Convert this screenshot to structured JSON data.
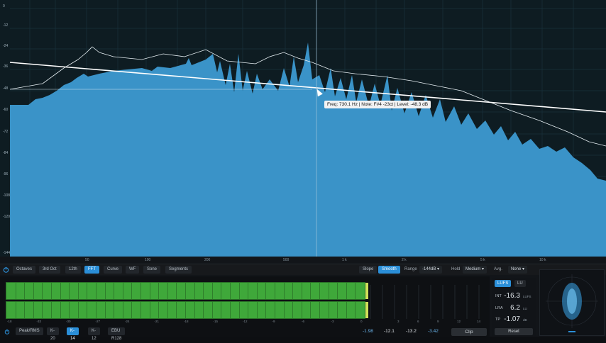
{
  "spectrum": {
    "y_labels": [
      "0",
      "-12",
      "-24",
      "-36",
      "-48",
      "-60",
      "-72",
      "-84",
      "-96",
      "-108",
      "-120",
      "-144"
    ],
    "x_labels": [
      "50",
      "100",
      "200",
      "500",
      "1 k",
      "2 k",
      "5 k",
      "10 k"
    ],
    "tooltip": "Freq: 730.1 Hz | Note: F#4 -23ct | Level: -48.3 dB",
    "fill_color": "#3a93c8"
  },
  "toolbar": {
    "view_modes": [
      "Octaves",
      "3rd Oct",
      "12th",
      "FFT",
      "Curve",
      "WF",
      "Sone",
      "Segments"
    ],
    "active_view": "FFT",
    "slope_label": "Slope",
    "smooth_label": "Smooth",
    "range_label": "Range",
    "range_value": "-144dB",
    "hold_label": "Hold",
    "hold_value": "Medium",
    "avg_label": "Avg.",
    "avg_value": "None"
  },
  "meter": {
    "scale": [
      "-18",
      "-33",
      "-30",
      "-27",
      "-24",
      "-21",
      "-18",
      "-15",
      "-12",
      "-9",
      "-6",
      "-3",
      "0"
    ],
    "tp_scale": [
      "3",
      "6",
      "9",
      "12",
      "14"
    ],
    "modes": [
      "Peak/RMS",
      "K-20",
      "K-14",
      "K-12",
      "EBU R128"
    ],
    "active_mode": "K-14",
    "readouts": [
      "-1.98",
      "-12.1",
      "-13.2",
      "-3.42"
    ],
    "clip_label": "Clip"
  },
  "loudness": {
    "tabs": [
      "LUFS",
      "LU"
    ],
    "active_tab": "LUFS",
    "rows": [
      {
        "label": "INT",
        "value": "-16.3",
        "unit": "LUFS"
      },
      {
        "label": "LRA",
        "value": "6.2",
        "unit": "LU"
      },
      {
        "label": "TP",
        "value": "-1.07",
        "unit": "dB"
      }
    ],
    "reset_label": "Reset"
  }
}
